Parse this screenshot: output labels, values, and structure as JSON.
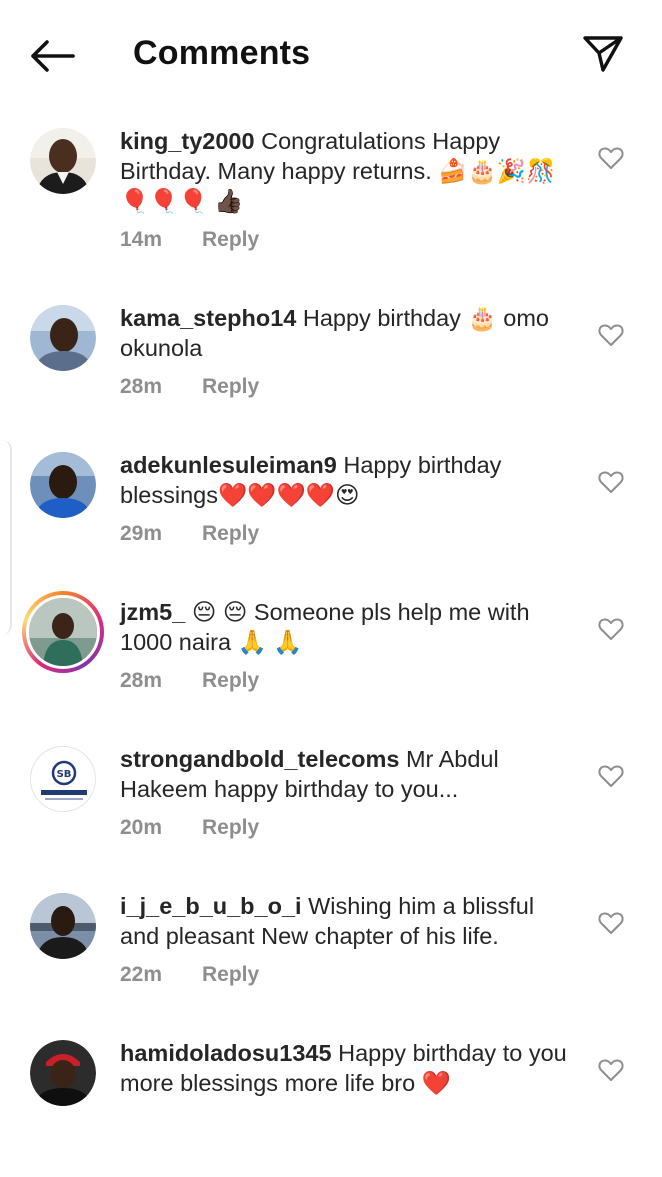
{
  "header": {
    "title": "Comments",
    "back_icon": "arrow-left-icon",
    "share_icon": "paper-plane-icon"
  },
  "reply_label": "Reply",
  "colors": {
    "text": "#262626",
    "muted": "#8e8e8e",
    "heart_outline": "#8e8e8e",
    "story_ring": [
      "#f58529",
      "#dd2a7b",
      "#8134af",
      "#feda77"
    ],
    "heart_emoji": "#e0182d",
    "balloon": "#f0541e"
  },
  "comments": [
    {
      "username": "king_ty2000",
      "text": " Congratulations Happy Birthday. Many happy returns. 🍰🎂🎉🎊🎈🎈🎈 👍🏿",
      "time": "14m"
    },
    {
      "username": "kama_stepho14",
      "text": " Happy birthday 🎂 omo okunola",
      "time": "28m"
    },
    {
      "username": "adekunlesuleiman9",
      "text": " Happy birthday blessings❤️❤️❤️❤️😍",
      "time": "29m"
    },
    {
      "username": "jzm5_",
      "text": " 😔 😔 Someone pls help me with 1000 naira 🙏 🙏",
      "time": "28m"
    },
    {
      "username": "strongandbold_telecoms",
      "text": " Mr Abdul Hakeem happy birthday to you...",
      "time": "20m"
    },
    {
      "username": "i_j_e_b_u_b_o_i",
      "text": " Wishing him a blissful and pleasant New chapter of his life.",
      "time": "22m"
    },
    {
      "username": "hamidoladosu1345",
      "text": " Happy birthday to you more blessings more life bro ❤️",
      "time": ""
    }
  ]
}
